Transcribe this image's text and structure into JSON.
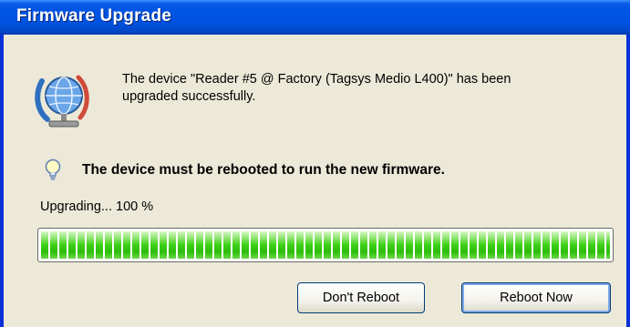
{
  "window": {
    "title": "Firmware Upgrade"
  },
  "message": {
    "line1": "The device \"Reader #5 @ Factory (Tagsys Medio L400)\" has been",
    "line2": "upgraded successfully."
  },
  "warning": {
    "text": "The device must be rebooted to run the new firmware."
  },
  "status": {
    "text": "Upgrading... 100 %"
  },
  "progress": {
    "value_percent": 100,
    "fill_color": "#3bd016"
  },
  "buttons": {
    "dont_reboot": "Don't Reboot",
    "reboot_now": "Reboot Now"
  },
  "icons": {
    "device": "globe-network-icon",
    "hint": "lightbulb-icon"
  }
}
